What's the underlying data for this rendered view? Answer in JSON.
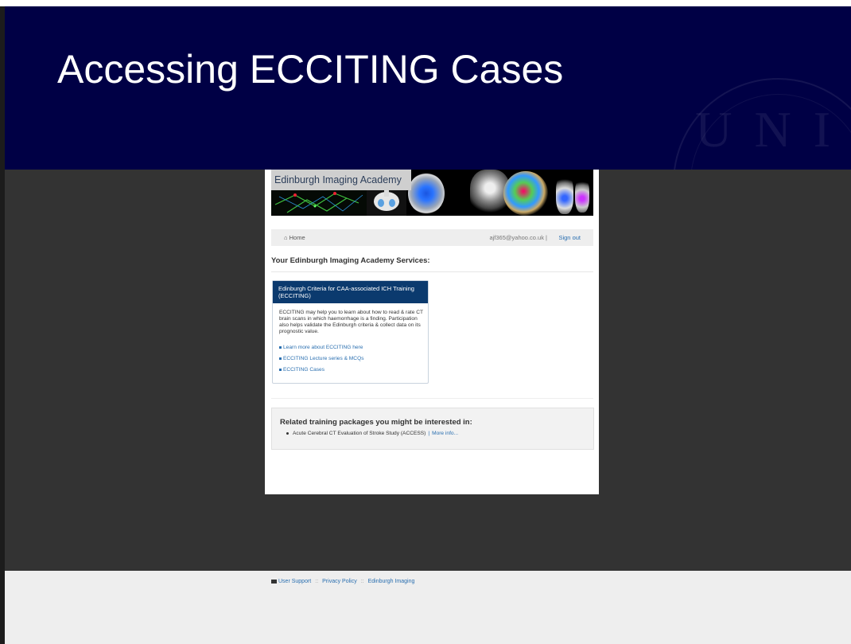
{
  "slide": {
    "title": "Accessing ECCITING Cases"
  },
  "banner": {
    "title": "Edinburgh Imaging Academy"
  },
  "nav": {
    "home_label": "Home",
    "user_email": "ajf365@yahoo.co.uk |",
    "sign_out": "Sign out"
  },
  "services": {
    "heading": "Your Edinburgh Imaging Academy Services:"
  },
  "panel": {
    "title": "Edinburgh Criteria for CAA-associated ICH Training (ECCITING)",
    "description": "ECCITING may help you to learn about how to read & rate CT brain scans in which haemorrhage is a finding. Participation also helps validate the Edinburgh criteria & collect data on its prognostic value.",
    "links": [
      "Learn more about ECCITING here",
      "ECCITING Lecture series & MCQs",
      "ECCITING Cases"
    ]
  },
  "related": {
    "heading": "Related training packages you might be interested in:",
    "item": "Acute Cerebral CT Evaluation of Stroke Study (ACCESS)",
    "separator": "|",
    "more": "More info..."
  },
  "footer": {
    "links": [
      "User Support",
      "Privacy Policy",
      "Edinburgh Imaging"
    ],
    "separator": "::"
  },
  "colors": {
    "title_bar": "#000045",
    "panel_header": "#0b3a6e",
    "link": "#2a6fb0",
    "dark_area": "#333333"
  }
}
